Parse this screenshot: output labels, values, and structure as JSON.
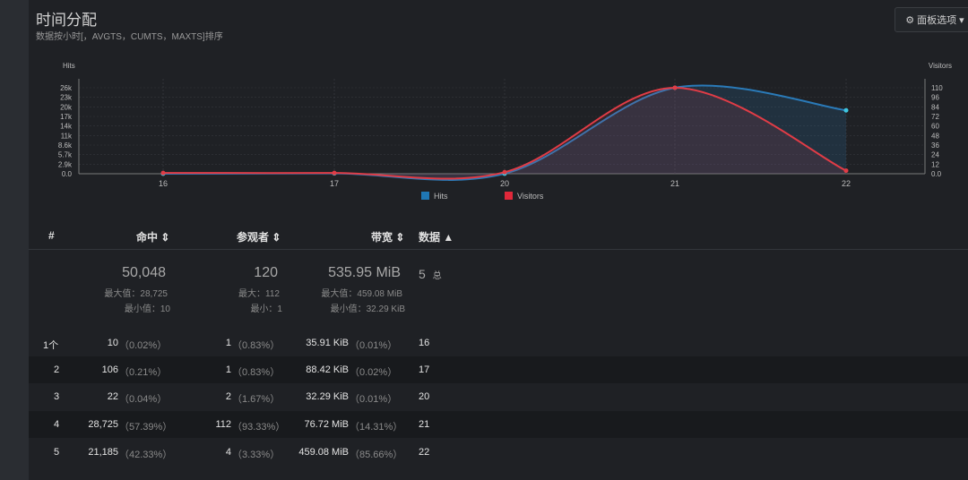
{
  "panel": {
    "title": "时间分配",
    "subtitle": "数据按小时[，AVGTS，CUMTS，MAXTS]排序",
    "options_label": "面板选项"
  },
  "chart_data": {
    "type": "area",
    "x": [
      "16",
      "17",
      "20",
      "21",
      "22"
    ],
    "series": [
      {
        "name": "Hits",
        "axis": "left",
        "values": [
          10,
          106,
          22,
          28725,
          21185
        ],
        "color": "#2a7ab8"
      },
      {
        "name": "Visitors",
        "axis": "right",
        "values": [
          1,
          1,
          2,
          112,
          4
        ],
        "color": "#e03c46"
      }
    ],
    "y_left_label": "Hits",
    "y_left_ticks": [
      "26k",
      "23k",
      "20k",
      "17k",
      "14k",
      "11k",
      "8.6k",
      "5.7k",
      "2.9k",
      "0.0"
    ],
    "y_right_label": "Visitors",
    "y_right_ticks": [
      "110",
      "96",
      "84",
      "72",
      "60",
      "48",
      "36",
      "24",
      "12",
      "0.0"
    ],
    "y_left_lim": [
      0,
      28725
    ],
    "y_right_lim": [
      0,
      112
    ],
    "legend": [
      {
        "name": "Hits",
        "color": "#1f77b4"
      },
      {
        "name": "Visitors",
        "color": "#e0283a"
      }
    ],
    "legend_position": "bottom-center"
  },
  "table": {
    "headers": {
      "index": "#",
      "hits": "命中",
      "visitors": "参观者",
      "bandwidth": "带宽",
      "data": "数据"
    },
    "summary": {
      "hits_total": "50,048",
      "hits_max": "最大值：28,725",
      "hits_min": "最小值：10",
      "visitors_total": "120",
      "visitors_max": "最大：112",
      "visitors_min": "最小：1",
      "bw_total": "535.95 MiB",
      "bw_max": "最大值：459.08 MiB",
      "bw_min": "最小值：32.29 KiB",
      "data_count": "5",
      "data_label": "总"
    },
    "rows": [
      {
        "idx": "1个",
        "hits": "10",
        "hits_pct": "（0.02%）",
        "visitors": "1",
        "visitors_pct": "（0.83%）",
        "bw": "35.91 KiB",
        "bw_pct": "（0.01%）",
        "data": "16"
      },
      {
        "idx": "2",
        "hits": "106",
        "hits_pct": "（0.21%）",
        "visitors": "1",
        "visitors_pct": "（0.83%）",
        "bw": "88.42 KiB",
        "bw_pct": "（0.02%）",
        "data": "17"
      },
      {
        "idx": "3",
        "hits": "22",
        "hits_pct": "（0.04%）",
        "visitors": "2",
        "visitors_pct": "（1.67%）",
        "bw": "32.29 KiB",
        "bw_pct": "（0.01%）",
        "data": "20"
      },
      {
        "idx": "4",
        "hits": "28,725",
        "hits_pct": "（57.39%）",
        "visitors": "112",
        "visitors_pct": "（93.33%）",
        "bw": "76.72 MiB",
        "bw_pct": "（14.31%）",
        "data": "21"
      },
      {
        "idx": "5",
        "hits": "21,185",
        "hits_pct": "（42.33%）",
        "visitors": "4",
        "visitors_pct": "（3.33%）",
        "bw": "459.08 MiB",
        "bw_pct": "（85.66%）",
        "data": "22"
      }
    ]
  },
  "icons": {
    "options": "gear-icon",
    "options_caret": "caret-down-icon",
    "sort": "sort-both-icon",
    "sort_up": "sort-asc-icon"
  }
}
